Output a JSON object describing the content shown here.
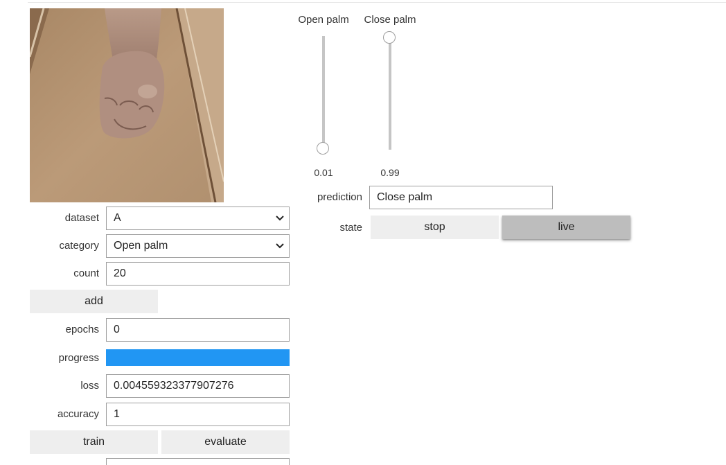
{
  "camera": {
    "alt": "hand"
  },
  "left": {
    "dataset": {
      "label": "dataset",
      "value": "A"
    },
    "category": {
      "label": "category",
      "value": "Open palm"
    },
    "count": {
      "label": "count",
      "value": "20"
    },
    "add_label": "add",
    "epochs": {
      "label": "epochs",
      "value": "0"
    },
    "progress": {
      "label": "progress",
      "value": 1.0
    },
    "loss": {
      "label": "loss",
      "value": "0.004559323377907276"
    },
    "accuracy": {
      "label": "accuracy",
      "value": "1"
    },
    "train_label": "train",
    "evaluate_label": "evaluate"
  },
  "sliders": [
    {
      "label": "Open palm",
      "value": "0.01",
      "fraction": 0.01
    },
    {
      "label": "Close palm",
      "value": "0.99",
      "fraction": 0.99
    }
  ],
  "prediction": {
    "label": "prediction",
    "value": "Close palm"
  },
  "state": {
    "label": "state",
    "stop_label": "stop",
    "live_label": "live",
    "active": "live"
  },
  "colors": {
    "progress": "#2196f3",
    "active_button": "#bdbdbd",
    "button": "#eeeeee"
  }
}
